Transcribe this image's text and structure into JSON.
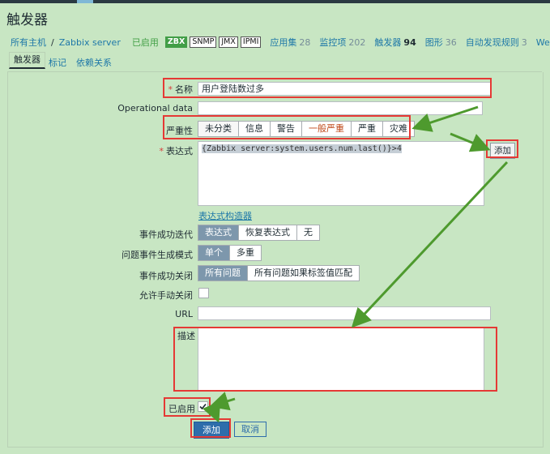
{
  "page": {
    "title": "触发器"
  },
  "breadcrumb": {
    "all_hosts": "所有主机",
    "separator": "/",
    "host": "Zabbix server",
    "status": "已启用"
  },
  "availability": {
    "zbx": "ZBX",
    "snmp": "SNMP",
    "jmx": "JMX",
    "ipmi": "IPMI"
  },
  "host_nav": [
    {
      "label": "应用集",
      "count": "28"
    },
    {
      "label": "监控项",
      "count": "202"
    },
    {
      "label": "触发器",
      "count": "94"
    },
    {
      "label": "图形",
      "count": "36"
    },
    {
      "label": "自动发现规则",
      "count": "3"
    },
    {
      "label": "Web 场景",
      "count": ""
    }
  ],
  "form_tabs": [
    "触发器",
    "标记",
    "依赖关系"
  ],
  "form": {
    "name_label": "名称",
    "name_value": "用户登陆数过多",
    "opdata_label": "Operational data",
    "opdata_value": "",
    "severity_label": "严重性",
    "severity_options": [
      "未分类",
      "信息",
      "警告",
      "一般严重",
      "严重",
      "灾难"
    ],
    "severity_selected": "未分类",
    "expression_label": "表达式",
    "expression_value": "{Zabbix server:system.users.num.last()}>4",
    "expression_add": "添加",
    "expression_builder": "表达式构造器",
    "ok_event_label": "事件成功迭代",
    "ok_event_options": [
      "表达式",
      "恢复表达式",
      "无"
    ],
    "ok_event_selected": "表达式",
    "problem_mode_label": "问题事件生成模式",
    "problem_mode_options": [
      "单个",
      "多重"
    ],
    "problem_mode_selected": "单个",
    "ok_close_label": "事件成功关闭",
    "ok_close_options": [
      "所有问题",
      "所有问题如果标签值匹配"
    ],
    "ok_close_selected": "所有问题",
    "manual_close_label": "允许手动关闭",
    "url_label": "URL",
    "url_value": "",
    "description_label": "描述",
    "description_value": "",
    "enabled_label": "已启用",
    "submit": "添加",
    "cancel": "取消"
  },
  "colors": {
    "background": "#c8e6c3",
    "link": "#1e78a8",
    "annotation_red": "#e53935",
    "annotation_arrow": "#4e9a2e",
    "primary": "#2e6dab"
  }
}
